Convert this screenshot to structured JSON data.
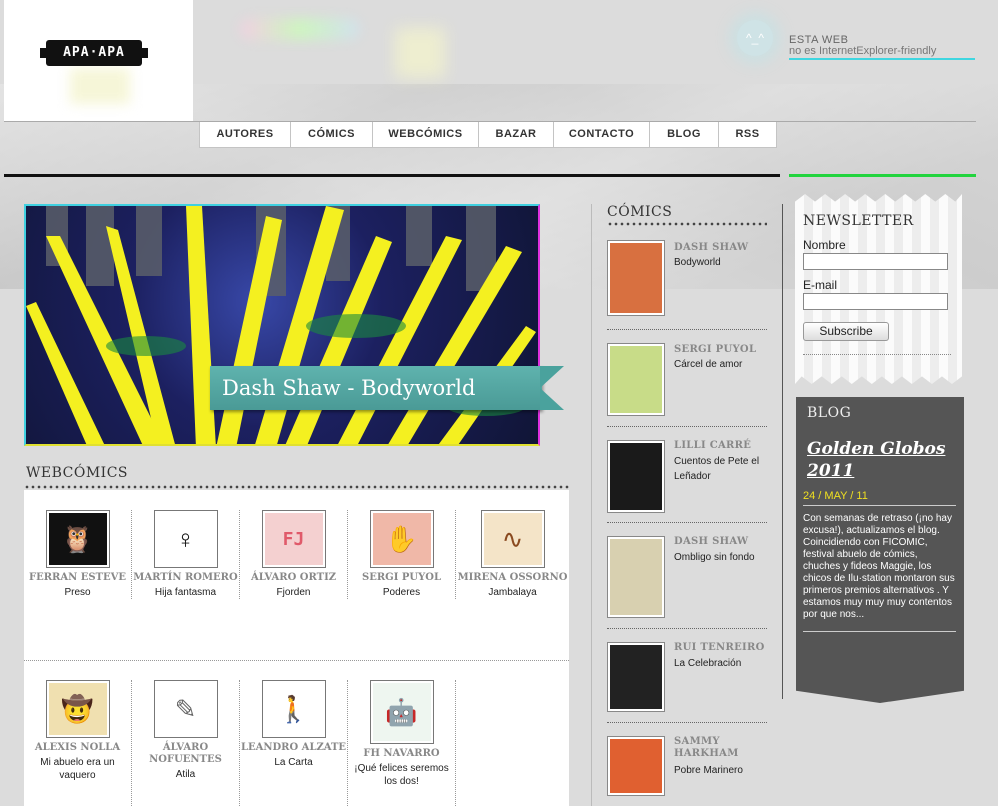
{
  "header": {
    "logo_text": "APA·APA",
    "ie_notice_title": "ESTA WEB",
    "ie_notice_sub": "no es InternetExplorer-friendly",
    "face": "^_^"
  },
  "nav": [
    "AUTORES",
    "CÓMICS",
    "WEBCÓMICS",
    "BAZAR",
    "CONTACTO",
    "BLOG",
    "RSS"
  ],
  "hero": {
    "caption": "Dash Shaw - Bodyworld"
  },
  "webcomics": {
    "title": "WEBCÓMICS",
    "items": [
      {
        "author": "FERRAN ESTEVE",
        "title": "Preso",
        "icon": "owl-icon",
        "glyph": "🦉"
      },
      {
        "author": "MARTÍN ROMERO",
        "title": "Hija fantasma",
        "icon": "ghost-girl-icon",
        "glyph": "♀"
      },
      {
        "author": "ÁLVARO ORTIZ",
        "title": "Fjorden",
        "icon": "fjorden-icon",
        "glyph": "FJ"
      },
      {
        "author": "SERGI PUYOL",
        "title": "Poderes",
        "icon": "hands-icon",
        "glyph": "✋"
      },
      {
        "author": "MIRENA OSSORNO",
        "title": "Jambalaya",
        "icon": "snake-icon",
        "glyph": "∿"
      },
      {
        "author": "ALEXIS NOLLA",
        "title": "Mi abuelo era un vaquero",
        "icon": "cowboy-icon",
        "glyph": "🤠"
      },
      {
        "author": "ÁLVARO NOFUENTES",
        "title": "Atila",
        "icon": "sketch-icon",
        "glyph": "✎"
      },
      {
        "author": "LEANDRO ALZATE",
        "title": "La Carta",
        "icon": "figure-icon",
        "glyph": "🚶"
      },
      {
        "author": "FH NAVARRO",
        "title": "¡Qué felices seremos los dos!",
        "icon": "robot-icon",
        "glyph": "🤖"
      }
    ]
  },
  "comics": {
    "title": "CÓMICS",
    "items": [
      {
        "author": "DASH SHAW",
        "title": "Bodyworld",
        "color": "#d87040"
      },
      {
        "author": "SERGI PUYOL",
        "title": "Cárcel de amor",
        "color": "#c8dc88"
      },
      {
        "author": "LILLI CARRÉ",
        "title": "Cuentos de Pete el Leñador",
        "color": "#1a1a1a"
      },
      {
        "author": "DASH SHAW",
        "title": "Ombligo sin fondo",
        "color": "#d8d0b0"
      },
      {
        "author": "RUI TENREIRO",
        "title": "La Celebración",
        "color": "#222222"
      },
      {
        "author": "SAMMY HARKHAM",
        "title": "Pobre Marinero",
        "color": "#e06030"
      }
    ]
  },
  "newsletter": {
    "title": "NEWSLETTER",
    "name_label": "Nombre",
    "email_label": "E-mail",
    "subscribe": "Subscribe"
  },
  "blog": {
    "title": "BLOG",
    "post_title": "Golden Globos 2011",
    "date": "24 / MAY / 11",
    "excerpt": "Con semanas de retraso (¡no hay excusa!), actualizamos el blog. Coincidiendo con FICOMIC, festival abuelo de cómics, chuches y fideos Maggie, los chicos de Ilu·station montaron sus primeros premios alternativos . Y estamos muy muy muy contentos por que nos..."
  },
  "colors": {
    "accent_cyan": "#3fd6e0",
    "accent_green": "#22d43e",
    "ribbon": "#4a9a96",
    "date_yellow": "#f0e020"
  }
}
